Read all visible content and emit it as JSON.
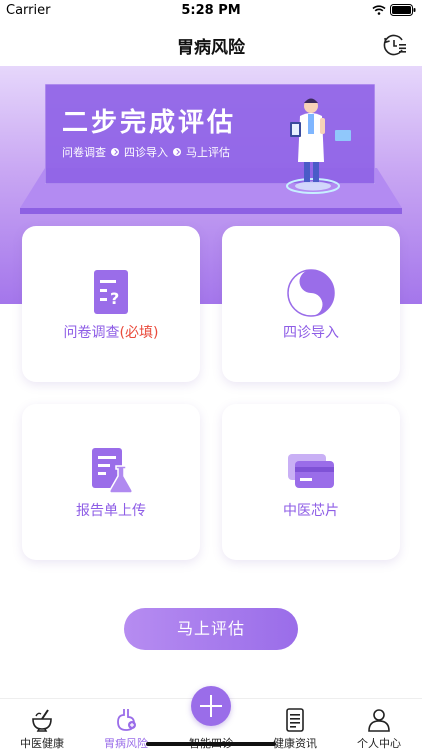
{
  "status": {
    "carrier": "Carrier",
    "time": "5:28 PM"
  },
  "header": {
    "title": "胃病风险"
  },
  "banner": {
    "title": "二步完成评估",
    "steps": [
      "问卷调查",
      "四诊导入",
      "马上评估"
    ]
  },
  "cards": [
    {
      "label": "问卷调查",
      "required": "(必填)",
      "icon": "questionnaire-icon"
    },
    {
      "label": "四诊导入",
      "icon": "yin-yang-icon"
    },
    {
      "label": "报告单上传",
      "icon": "report-flask-icon"
    },
    {
      "label": "中医芯片",
      "icon": "card-chip-icon"
    }
  ],
  "assess_button": "马上评估",
  "tabs": [
    {
      "label": "中医健康",
      "icon": "mortar-pestle-icon"
    },
    {
      "label": "胃病风险",
      "icon": "stomach-icon",
      "active": true
    },
    {
      "label": "智能四诊",
      "icon": "plus-icon"
    },
    {
      "label": "健康资讯",
      "icon": "news-icon"
    },
    {
      "label": "个人中心",
      "icon": "user-icon"
    }
  ],
  "colors": {
    "accent": "#9a6de9",
    "required": "#e94a3b"
  }
}
